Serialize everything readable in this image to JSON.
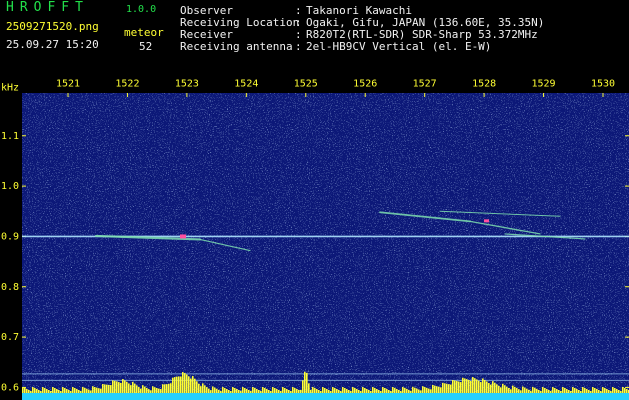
{
  "header": {
    "app_title": "HROFFT",
    "app_version": "1.0.0",
    "file_name": "2509271520.png",
    "timestamp": "25.09.27 15:20",
    "count_label": "meteor",
    "count_value": "52",
    "info": [
      {
        "label": "Observer",
        "value": "Takanori Kawachi"
      },
      {
        "label": "Receiving Location",
        "value": "Ogaki, Gifu, JAPAN (136.60E, 35.35N)"
      },
      {
        "label": "Receiver",
        "value": "R820T2(RTL-SDR) SDR-Sharp 53.372MHz"
      },
      {
        "label": "Receiving antenna",
        "value": "2el-HB9CV Vertical (el. E-W)"
      }
    ]
  },
  "spectrogram": {
    "y_unit": "kHz",
    "time_ticks": [
      "1521",
      "1522",
      "1523",
      "1524",
      "1525",
      "1526",
      "1527",
      "1528",
      "1529",
      "1530"
    ],
    "freq_ticks": [
      "1.1",
      "1.0",
      "0.9",
      "0.8",
      "0.7",
      "0.6"
    ],
    "freq_tick_values": [
      1.1,
      1.0,
      0.9,
      0.8,
      0.7,
      0.6
    ],
    "freq_range": [
      0.575,
      1.185
    ],
    "colors": {
      "background": "#0c1878",
      "axis_text": "#ffff33",
      "carrier": "#aee6ff",
      "echo": "#7fe0b0",
      "level_bar": "#ffff33",
      "baseline": "#25d0ff"
    }
  }
}
